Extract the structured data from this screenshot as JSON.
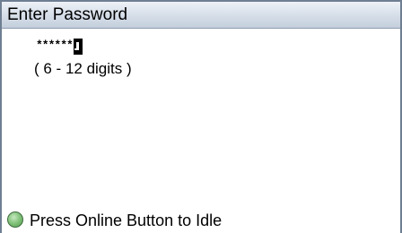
{
  "title_bar": {
    "title": "Enter Password"
  },
  "password_entry": {
    "masked_value": "******",
    "cursor_icon": "text-cursor-icon",
    "hint": "( 6 - 12 digits )"
  },
  "status": {
    "icon": "status-led-icon",
    "led_color": "#86c57f",
    "message": "Press Online Button to Idle"
  }
}
